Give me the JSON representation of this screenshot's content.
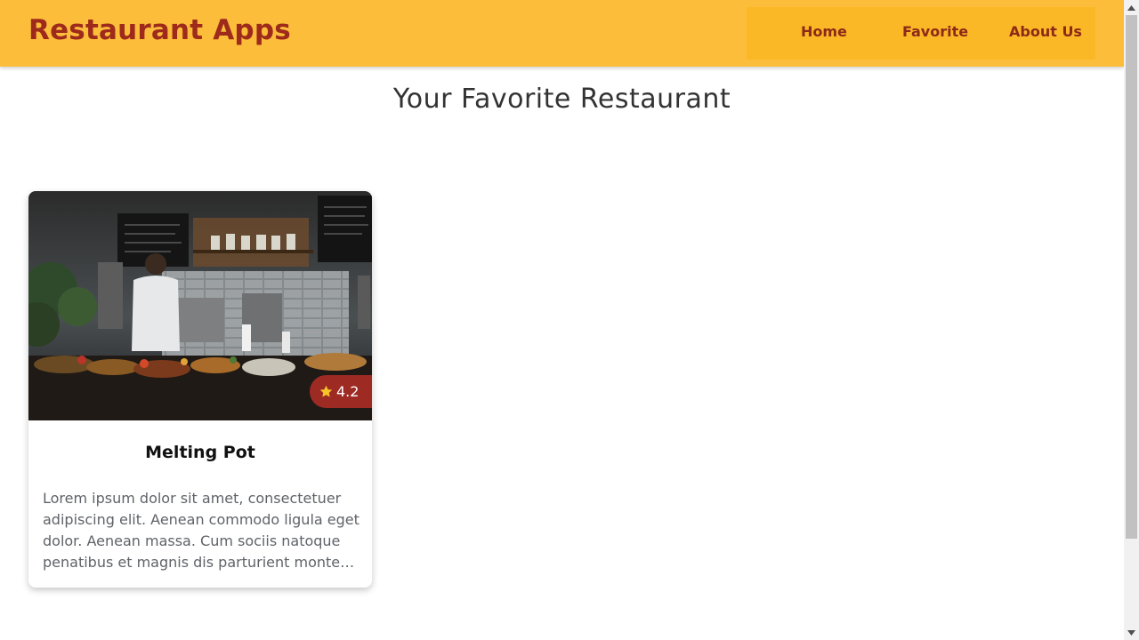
{
  "header": {
    "brand": "Restaurant Apps",
    "background_color": "#fbbd3a",
    "brand_color": "#9e2a1c",
    "nav": [
      {
        "label": "Home"
      },
      {
        "label": "Favorite"
      },
      {
        "label": "About Us"
      }
    ]
  },
  "main": {
    "title": "Your Favorite Restaurant",
    "restaurants": [
      {
        "name": "Melting Pot",
        "rating": "4.2",
        "rating_icon": "star-icon",
        "image": "restaurant-kitchen-photo",
        "description": "Lorem ipsum dolor sit amet, consectetuer adipiscing elit. Aenean commodo ligula eget dolor. Aenean massa. Cum sociis natoque penatibus et magnis dis parturient montes, nascetur ridiculus mus."
      }
    ]
  },
  "scrollbar": {
    "position_fraction": 0
  }
}
